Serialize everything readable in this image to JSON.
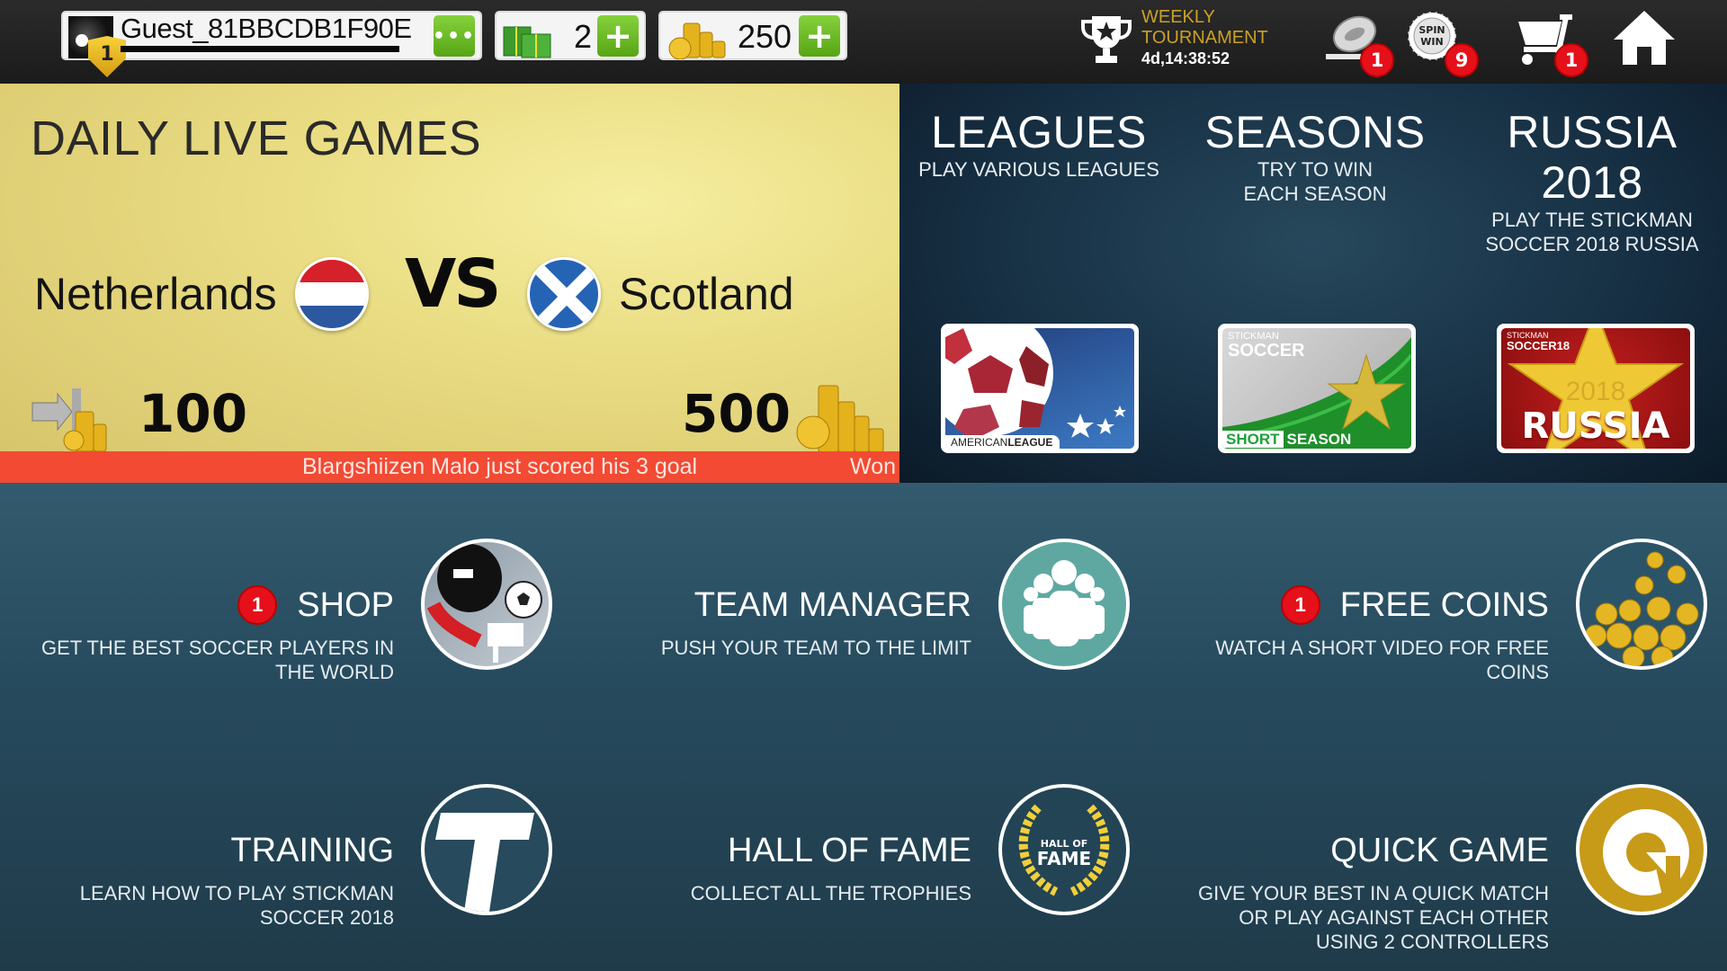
{
  "topbar": {
    "profile": {
      "username": "Guest_81BBCDB1F90E",
      "level": "1",
      "more_button": "•••",
      "xp_progress": 1.0
    },
    "cash": {
      "value": "2",
      "add_label": "+"
    },
    "coins": {
      "value": "250",
      "add_label": "+"
    },
    "tournament": {
      "line1": "WEEKLY",
      "line2": "TOURNAMENT",
      "timer": "4d,14:38:52"
    },
    "icons": [
      {
        "name": "coin-flip-icon",
        "badge": "1"
      },
      {
        "name": "spin-win-icon",
        "label_top": "SPIN",
        "label_bottom": "WIN",
        "badge": "9"
      },
      {
        "name": "cart-icon",
        "badge": "1"
      },
      {
        "name": "home-icon"
      }
    ]
  },
  "daily": {
    "title": "DAILY LIVE GAMES",
    "home_team": "Netherlands",
    "away_team": "Scotland",
    "vs": "VS",
    "entry_fee": "100",
    "prize": "500",
    "ticker_message": "Blargshiizen Malo just scored his 3 goal",
    "ticker_status": "Won"
  },
  "modes": [
    {
      "title": "LEAGUES",
      "subtitle": "PLAY VARIOUS LEAGUES",
      "card_label": "AMERICAN",
      "card_label_bold": "LEAGUE"
    },
    {
      "title": "SEASONS",
      "subtitle": "TRY TO WIN EACH SEASON",
      "card_brand_top": "STICKMAN",
      "card_brand": "SOCCER",
      "card_label": "SHORT",
      "card_label_bold": "SEASON"
    },
    {
      "title": "RUSSIA 2018",
      "subtitle": "PLAY THE STICKMAN SOCCER 2018 RUSSIA",
      "card_brand_top": "STICKMAN",
      "card_brand": "SOCCER18",
      "card_year": "2018",
      "card_label": "RUSSIA"
    }
  ],
  "menu": [
    {
      "title": "SHOP",
      "subtitle": "GET THE BEST SOCCER PLAYERS IN THE WORLD",
      "badge": "1"
    },
    {
      "title": "TEAM MANAGER",
      "subtitle": "PUSH YOUR TEAM TO THE LIMIT"
    },
    {
      "title": "FREE COINS",
      "subtitle": "WATCH A SHORT VIDEO FOR FREE COINS",
      "badge": "1"
    },
    {
      "title": "TRAINING",
      "subtitle": "LEARN HOW TO PLAY STICKMAN SOCCER 2018",
      "icon_letter": "T"
    },
    {
      "title": "HALL OF FAME",
      "subtitle": "COLLECT ALL THE TROPHIES",
      "icon_line1": "HALL OF",
      "icon_line2": "FAME"
    },
    {
      "title": "QUICK GAME",
      "subtitle": "GIVE YOUR BEST IN A QUICK MATCH OR PLAY AGAINST EACH OTHER USING 2 CONTROLLERS"
    }
  ],
  "colors": {
    "badge_red": "#e5101a",
    "add_green": "#6cbf26",
    "ticker_red": "#f24a33",
    "tournament_gold": "#c9a227",
    "team_teal": "#5fa8a2",
    "quick_gold": "#c79a18"
  }
}
